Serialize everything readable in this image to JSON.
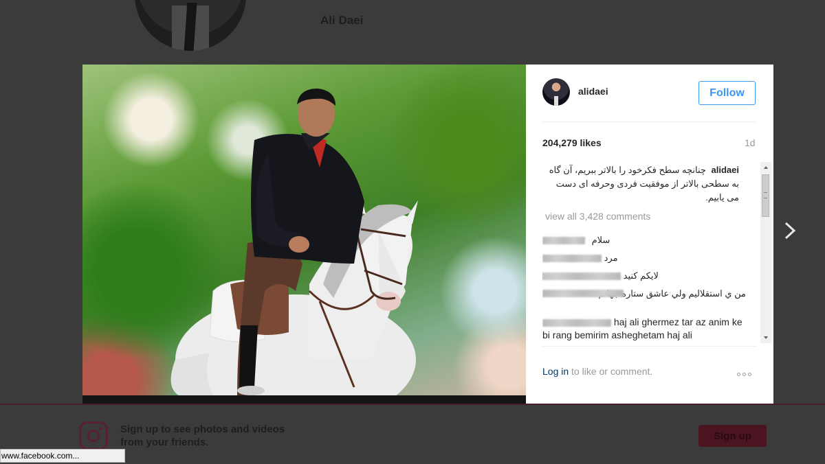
{
  "background_page": {
    "profile_name": "Ali Daei",
    "signup_prompt": "Sign up to see photos and videos from your friends.",
    "signup_button": "Sign up"
  },
  "status_bar": {
    "url_text": "www.facebook.com..."
  },
  "post": {
    "username": "alidaei",
    "follow_label": "Follow",
    "likes": "204,279 likes",
    "time_ago": "1d",
    "caption": {
      "user": "alidaei",
      "text": "چنانچه سطح فکرخود را بالاتر ببریم، آن گاه به سطحی بالاتر از موفقیت فردی وحرفه ای دست می یابیم."
    },
    "view_all_comments": "view all 3,428 comments",
    "comments": [
      {
        "text": "سلام"
      },
      {
        "text": "مرد"
      },
      {
        "text": "لایکم کنید"
      },
      {
        "text": "من ي استقلاليم ولي عاشق ستاره جهانم"
      },
      {
        "text": "haj ali ghermez tar az anim ke bi rang bemirim asheghetam haj ali"
      }
    ],
    "login_link": "Log in",
    "login_suffix": " to like or comment."
  },
  "icons": {
    "next": "chevron-right-icon",
    "more": "more-options-icon",
    "instagram": "instagram-icon"
  },
  "colors": {
    "accent_blue": "#3897f0",
    "link_dark_blue": "#003569",
    "overlay_bg": "#3b3b3b"
  }
}
